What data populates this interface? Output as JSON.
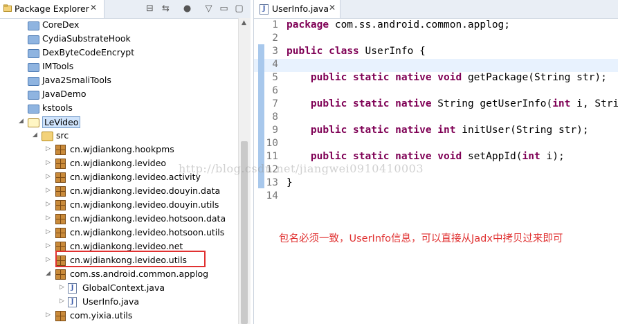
{
  "package_explorer": {
    "tab_label": "Package Explorer",
    "tab_close": "✕",
    "toolbar_icons": [
      "collapse-all-icon",
      "link-with-editor-icon",
      "focus-icon",
      "view-menu-icon",
      "minimize-icon",
      "maximize-icon"
    ],
    "tree": [
      {
        "label": "CoreDex",
        "kind": "project"
      },
      {
        "label": "CydiaSubstrateHook",
        "kind": "project"
      },
      {
        "label": "DexByteCodeEncrypt",
        "kind": "project"
      },
      {
        "label": "IMTools",
        "kind": "project"
      },
      {
        "label": "Java2SmaliTools",
        "kind": "project"
      },
      {
        "label": "JavaDemo",
        "kind": "project"
      },
      {
        "label": "kstools",
        "kind": "project"
      },
      {
        "label": "LeVideo",
        "kind": "project-open"
      },
      {
        "label": "src",
        "kind": "source-folder"
      },
      {
        "label": "cn.wjdiankong.hookpms",
        "kind": "package"
      },
      {
        "label": "cn.wjdiankong.levideo",
        "kind": "package"
      },
      {
        "label": "cn.wjdiankong.levideo.activity",
        "kind": "package"
      },
      {
        "label": "cn.wjdiankong.levideo.douyin.data",
        "kind": "package"
      },
      {
        "label": "cn.wjdiankong.levideo.douyin.utils",
        "kind": "package"
      },
      {
        "label": "cn.wjdiankong.levideo.hotsoon.data",
        "kind": "package"
      },
      {
        "label": "cn.wjdiankong.levideo.hotsoon.utils",
        "kind": "package"
      },
      {
        "label": "cn.wjdiankong.levideo.net",
        "kind": "package"
      },
      {
        "label": "cn.wjdiankong.levideo.utils",
        "kind": "package"
      },
      {
        "label": "com.ss.android.common.applog",
        "kind": "package-open"
      },
      {
        "label": "GlobalContext.java",
        "kind": "java"
      },
      {
        "label": "UserInfo.java",
        "kind": "java"
      },
      {
        "label": "com.yixia.utils",
        "kind": "package"
      }
    ]
  },
  "editor": {
    "tab_label": "UserInfo.java",
    "tab_close": "✕",
    "lines": [
      {
        "n": "1",
        "code": "package com.ss.android.common.applog;"
      },
      {
        "n": "2",
        "code": ""
      },
      {
        "n": "3",
        "code": "public class UserInfo {"
      },
      {
        "n": "4",
        "code": ""
      },
      {
        "n": "5",
        "code": "    public static native void getPackage(String str);"
      },
      {
        "n": "6",
        "code": ""
      },
      {
        "n": "7",
        "code": "    public static native String getUserInfo(int i, String"
      },
      {
        "n": "8",
        "code": ""
      },
      {
        "n": "9",
        "code": "    public static native int initUser(String str);"
      },
      {
        "n": "10",
        "code": ""
      },
      {
        "n": "11",
        "code": "    public static native void setAppId(int i);"
      },
      {
        "n": "12",
        "code": ""
      },
      {
        "n": "13",
        "code": "}"
      },
      {
        "n": "14",
        "code": ""
      }
    ],
    "keywords": [
      "package",
      "public",
      "class",
      "static",
      "native",
      "void",
      "int"
    ]
  },
  "watermark": "http://blog.csdn.net/jiangwei0910410003",
  "annotation": "包名必须一致，UserInfo信息，可以直接从Jadx中拷贝过来即可",
  "colors": {
    "highlight_box": "#e03131",
    "keyword": "#7f0055",
    "selection": "#cfe3fb"
  }
}
